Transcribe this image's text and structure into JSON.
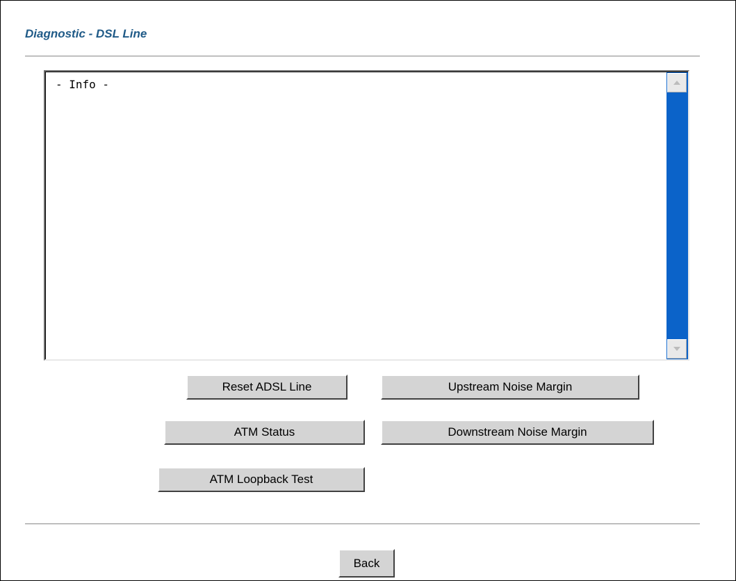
{
  "page": {
    "title": "Diagnostic - DSL Line"
  },
  "info_box": {
    "text": "- Info -"
  },
  "buttons": {
    "reset_adsl_line": "Reset ADSL Line",
    "upstream_noise_margin": "Upstream Noise Margin",
    "atm_status": "ATM Status",
    "downstream_noise_margin": "Downstream Noise Margin",
    "atm_loopback_test": "ATM Loopback Test",
    "back": "Back"
  },
  "colors": {
    "title": "#1f5a87",
    "scrollbar": "#0b63c9",
    "button_face": "#d4d4d4"
  },
  "icons": {
    "scroll_up": "scroll-up-arrow-icon",
    "scroll_down": "scroll-down-arrow-icon"
  }
}
